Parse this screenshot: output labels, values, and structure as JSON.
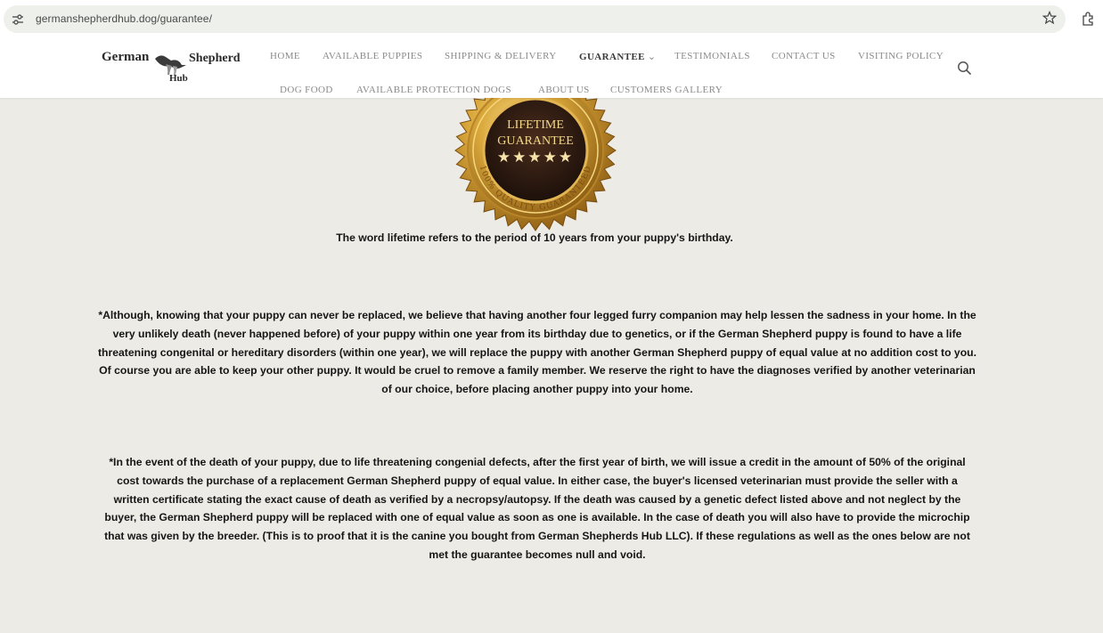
{
  "browser": {
    "url": "germanshepherdhub.dog/guarantee/",
    "icons": [
      "site-settings-icon",
      "bookmark-star-icon",
      "extensions-icon"
    ]
  },
  "header": {
    "logo": {
      "word1": "German",
      "word2": "Shepherd",
      "word3": "Hub"
    },
    "nav_row1": [
      {
        "label": "HOME"
      },
      {
        "label": "AVAILABLE PUPPIES"
      },
      {
        "label": "SHIPPING & DELIVERY"
      },
      {
        "label": "GUARANTEE",
        "active": true
      },
      {
        "label": "TESTIMONIALS"
      },
      {
        "label": "CONTACT US"
      },
      {
        "label": "VISITING POLICY"
      }
    ],
    "nav_row2": [
      {
        "label": "DOG FOOD"
      },
      {
        "label": "AVAILABLE PROTECTION DOGS"
      },
      {
        "label": "ABOUT US"
      },
      {
        "label": "CUSTOMERS GALLERY"
      }
    ],
    "dropdown_chevron": "⌄"
  },
  "badge": {
    "line1": "LIFETIME",
    "line2": "GUARANTEE",
    "stars": "★★★★★",
    "ring_text": "100% QUALITY GUARANTEED"
  },
  "content": {
    "lead": "The word lifetime refers to the period of 10 years from your puppy's birthday.",
    "paragraph1": "*Although, knowing that your puppy can never be replaced, we believe that having another four legged furry companion may help lessen the sadness in your home. In the very unlikely death (never happened before) of your puppy within one year from its birthday due to genetics, or if the German Shepherd puppy is found to have a life threatening congenital or hereditary disorders (within one year), we will replace the puppy with another German Shepherd puppy of equal value at no addition cost to you. Of course you are able to keep your other puppy. It would be cruel to remove a family member. We reserve the right to have the diagnoses verified by another veterinarian of our choice, before placing another puppy into your home.",
    "paragraph2": "*In the event of the death of your puppy, due to life threatening congenial defects, after the first year of birth, we will issue a credit in the amount of 50% of the original cost towards the purchase of a replacement German Shepherd puppy of equal value. In either case, the buyer's licensed veterinarian must provide the seller with a written certificate stating the exact cause of death as verified by a necropsy/autopsy. If the death was caused by a genetic defect listed above and not neglect by the buyer, the German Shepherd puppy will be replaced with one of equal value as soon as one is available. In the case of death you will also have to provide the microchip that was given by the breeder. (This is to proof that it is the canine you bought from German Shepherds Hub LLC). If these regulations as well as the ones below are not met the guarantee becomes null and void."
  },
  "colors": {
    "page_bg": "#ecebe6",
    "badge_gold": "#c9972e",
    "badge_dark": "#2a1a12"
  }
}
